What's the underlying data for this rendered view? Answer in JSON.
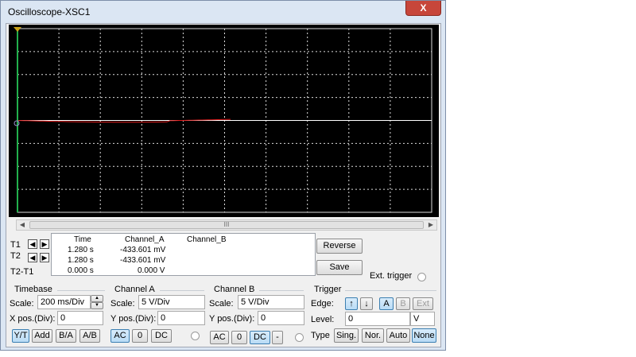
{
  "window": {
    "title": "Oscilloscope-XSC1",
    "close_label": "X"
  },
  "colors": {
    "channel_a_trace": "#e01b1b",
    "channel_b_trace": "#ffffff",
    "cursor_t1": "#22b14c",
    "grid": "#dcdcdc",
    "screen": "#000000"
  },
  "scrollbar": {
    "grip": "III"
  },
  "cursors": {
    "t1_label": "T1",
    "t2_label": "T2",
    "diff_label": "T2-T1",
    "left_arrow": "◀",
    "right_arrow": "▶",
    "headers": [
      "Time",
      "Channel_A",
      "Channel_B"
    ],
    "rows": [
      {
        "time": "1.280 s",
        "a": "-433.601 mV",
        "b": ""
      },
      {
        "time": "1.280 s",
        "a": "-433.601 mV",
        "b": ""
      },
      {
        "time": "0.000 s",
        "a": "0.000 V",
        "b": ""
      }
    ]
  },
  "side_buttons": {
    "reverse": "Reverse",
    "save": "Save",
    "ext_trigger": "Ext. trigger"
  },
  "timebase": {
    "title": "Timebase",
    "scale_label": "Scale:",
    "scale_value": "200 ms/Div",
    "xpos_label": "X pos.(Div):",
    "xpos_value": "0",
    "modes": [
      "Y/T",
      "Add",
      "B/A",
      "A/B"
    ]
  },
  "channel_a": {
    "title": "Channel A",
    "scale_label": "Scale:",
    "scale_value": "5  V/Div",
    "ypos_label": "Y pos.(Div):",
    "ypos_value": "0",
    "coupling": [
      "AC",
      "0",
      "DC"
    ]
  },
  "channel_b": {
    "title": "Channel B",
    "scale_label": "Scale:",
    "scale_value": "5  V/Div",
    "ypos_label": "Y pos.(Div):",
    "ypos_value": "0",
    "coupling": [
      "AC",
      "0",
      "DC",
      "-"
    ]
  },
  "trigger": {
    "title": "Trigger",
    "edge_label": "Edge:",
    "rise_icon": "↑",
    "fall_icon": "↓",
    "sources": [
      "A",
      "B",
      "Ext"
    ],
    "level_label": "Level:",
    "level_value": "0",
    "level_unit": "V",
    "type_label": "Type",
    "types": [
      "Sing.",
      "Nor.",
      "Auto",
      "None"
    ]
  }
}
